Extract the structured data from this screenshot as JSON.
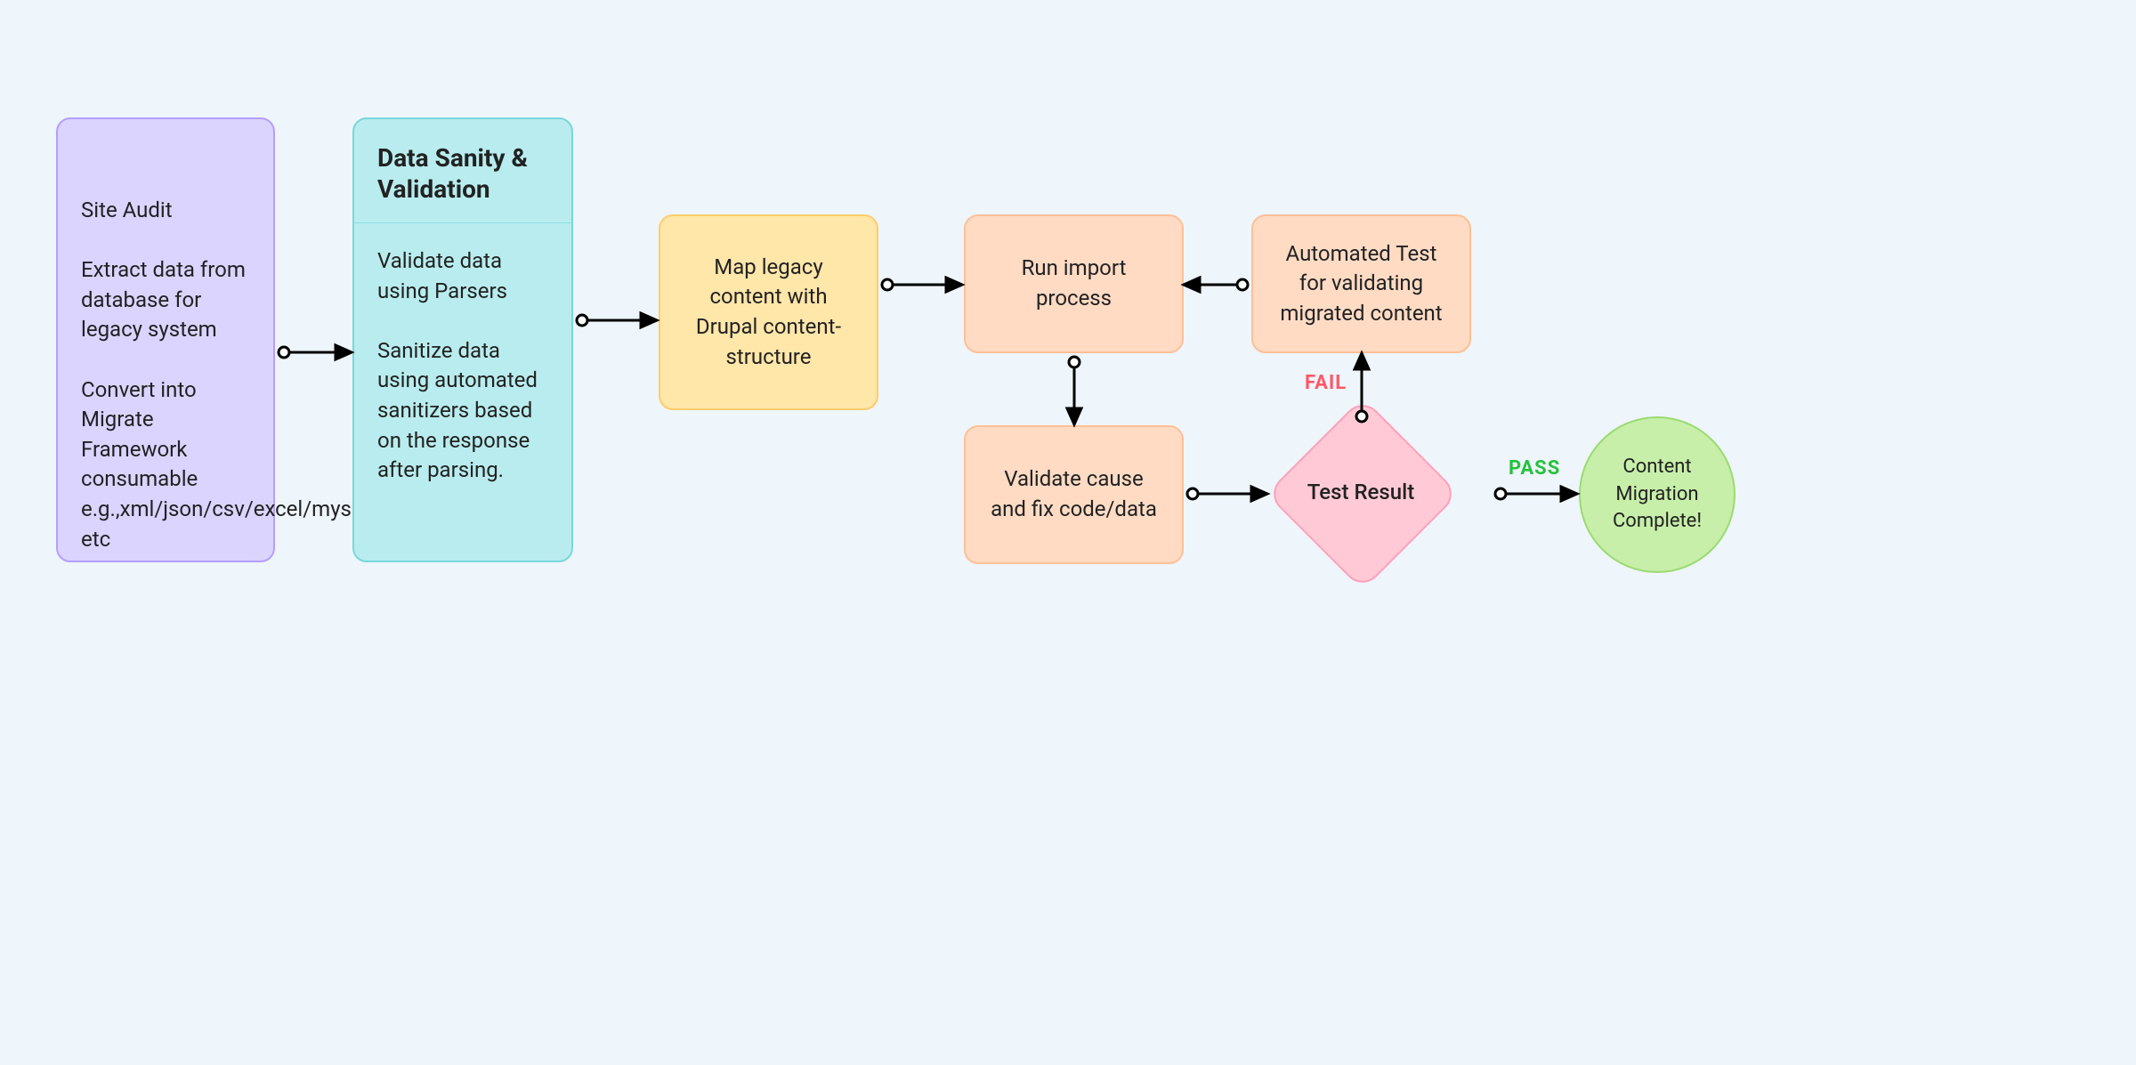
{
  "nodes": {
    "node1": {
      "lines": "Site Audit\n\nExtract data from database for legacy system\n\nConvert into Migrate Framework consumable e.g.,xml/json/csv/excel/mysql etc"
    },
    "node2": {
      "title": "Data Sanity & Validation",
      "body": "Validate data using Parsers\n\nSanitize data using automated sanitizers based on the response after parsing."
    },
    "node3": {
      "text": "Map legacy content with Drupal content-structure"
    },
    "node4": {
      "text": "Run import process"
    },
    "node5": {
      "text": "Automated Test for validating migrated content"
    },
    "node6": {
      "text": "Validate cause and fix code/data"
    },
    "decision": {
      "text": "Test Result"
    },
    "end": {
      "text": "Content Migration Complete!"
    }
  },
  "edges": {
    "pass": "PASS",
    "fail": "FAIL"
  },
  "colors": {
    "bg": "#eef5fb",
    "purple_fill": "#dbd4ff",
    "cyan_fill": "#b9ecee",
    "yellow_fill": "#ffe6a9",
    "peach_fill": "#ffdbc4",
    "pink_fill": "#ffcad6",
    "green_fill": "#c7efa9",
    "pass_text": "#25c23d",
    "fail_text": "#ff5867"
  }
}
